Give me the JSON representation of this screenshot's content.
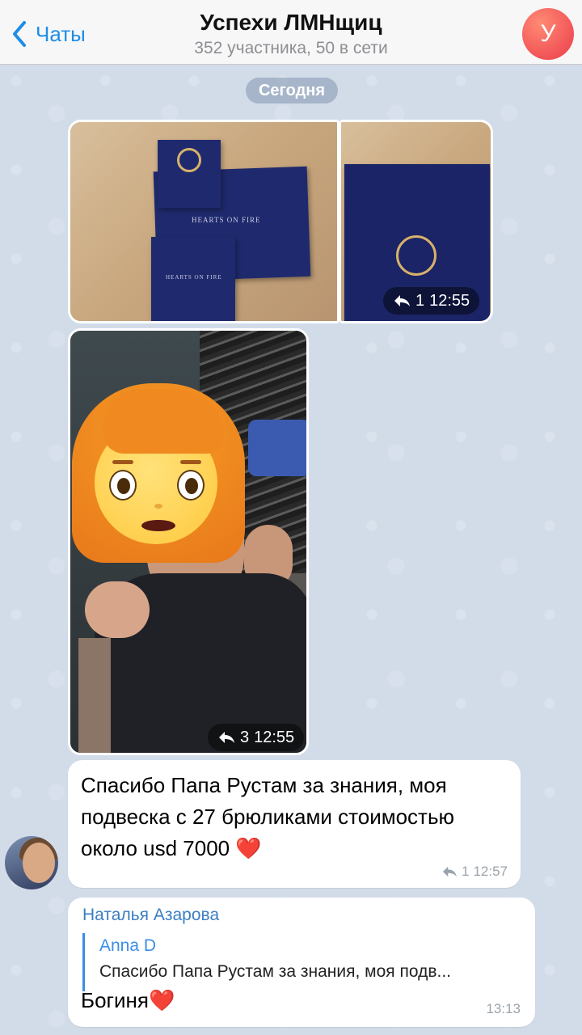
{
  "header": {
    "back_label": "Чаты",
    "title": "Успехи ЛМНщиц",
    "subtitle": "352 участника, 50 в сети",
    "avatar_letter": "У",
    "avatar_color": "#ec3b4a"
  },
  "date_separator": "Сегодня",
  "media": [
    {
      "name": "jewelry-box-photo",
      "brand": "HEARTS ON FIRE",
      "brand_small": "HEARTS ON FIRE"
    },
    {
      "name": "pendant-photo",
      "replies": "1",
      "time": "12:55"
    },
    {
      "name": "woman-photo",
      "replies": "3",
      "time": "12:55"
    }
  ],
  "messages": [
    {
      "text": "Спасибо Папа Рустам за знания, моя подвеска с 27 брюликами стоимостью около usd 7000",
      "emoji": "❤️",
      "replies": "1",
      "time": "12:57"
    },
    {
      "sender": "Наталья Азарова",
      "reply_to": {
        "name": "Anna D",
        "text": "Спасибо Папа Рустам за знания, моя подв..."
      },
      "text": "Богиня❤️",
      "time": "13:13"
    }
  ],
  "colors": {
    "accent": "#1d8de8",
    "chat_background": "#d2dce9",
    "sender_name": "#3a7ec2"
  }
}
